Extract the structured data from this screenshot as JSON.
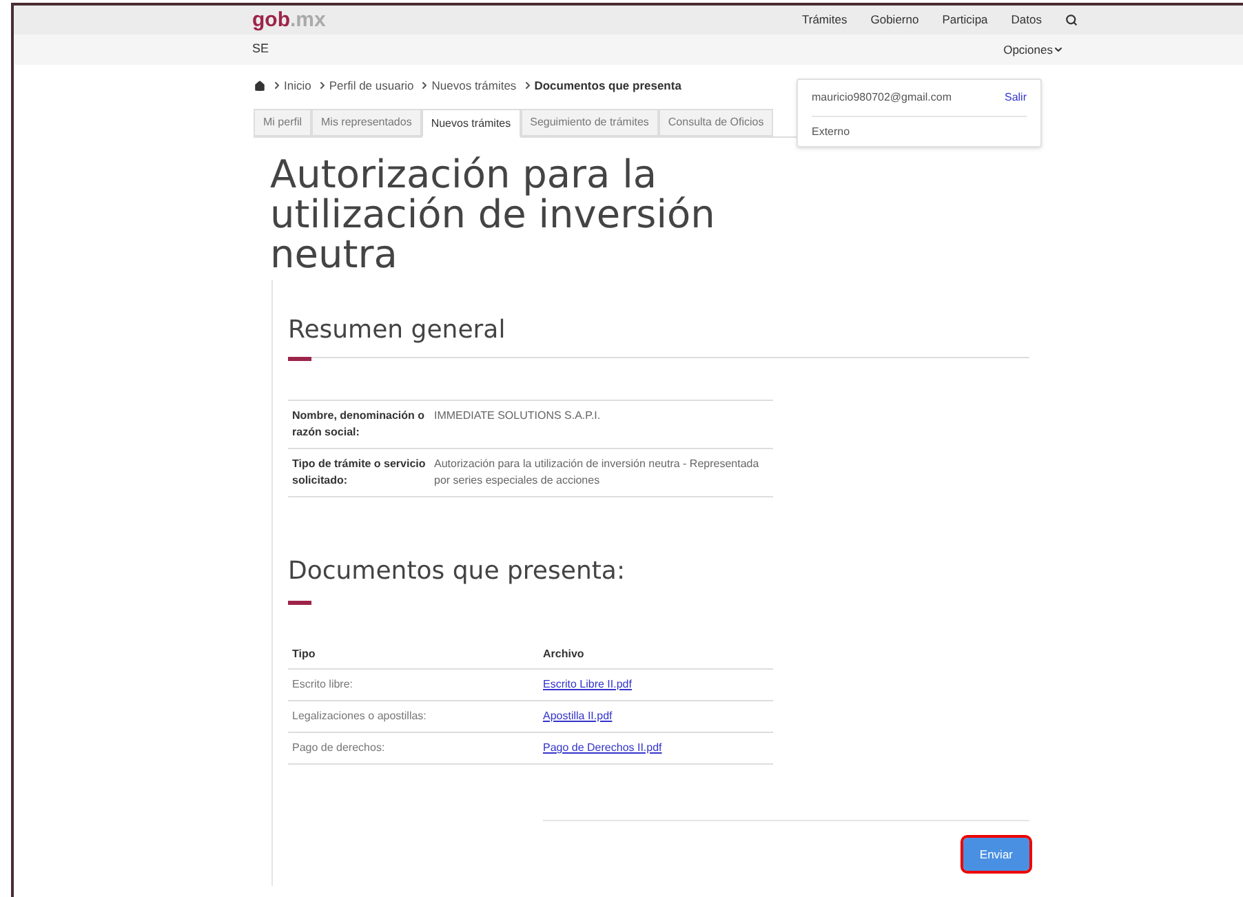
{
  "header": {
    "logo_bold": "gob",
    "logo_rest": ".mx",
    "nav": [
      "Trámites",
      "Gobierno",
      "Participa",
      "Datos"
    ]
  },
  "subheader": {
    "title": "SE",
    "options": "Opciones"
  },
  "breadcrumb": {
    "items": [
      "Inicio",
      "Perfil de usuario",
      "Nuevos trámites"
    ],
    "current": "Documentos que presenta"
  },
  "tabs": [
    {
      "label": "Mi perfil",
      "selected": false
    },
    {
      "label": "Mis representados",
      "selected": false
    },
    {
      "label": "Nuevos trámites",
      "selected": true
    },
    {
      "label": "Seguimiento de trámites",
      "selected": false
    },
    {
      "label": "Consulta de Oficios",
      "selected": false
    }
  ],
  "user_menu": {
    "email": "mauricio980702@gmail.com",
    "logout": "Salir",
    "role": "Externo"
  },
  "page_title": "Autorización para la utilización de inversión neutra",
  "summary": {
    "heading": "Resumen general",
    "rows": [
      {
        "label": "Nombre, denominación o razón social:",
        "value": "IMMEDIATE SOLUTIONS S.A.P.I."
      },
      {
        "label": "Tipo de trámite o servicio solicitado:",
        "value": "Autorización para la utilización de inversión neutra - Representada por series especiales de acciones"
      }
    ]
  },
  "documents": {
    "heading": "Documentos que presenta:",
    "columns": [
      "Tipo",
      "Archivo"
    ],
    "rows": [
      {
        "type": "Escrito libre:",
        "file": "Escrito Libre II.pdf"
      },
      {
        "type": "Legalizaciones o apostillas:",
        "file": "Apostilla II.pdf"
      },
      {
        "type": "Pago de derechos:",
        "file": "Pago de Derechos II.pdf"
      }
    ]
  },
  "submit": {
    "label": "Enviar",
    "highlighted": true
  }
}
